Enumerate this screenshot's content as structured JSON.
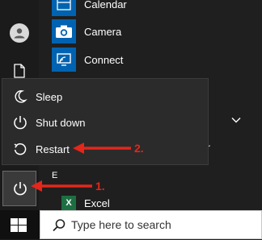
{
  "apps": [
    {
      "label": "Calendar",
      "icon": "calendar-icon"
    },
    {
      "label": "Camera",
      "icon": "camera-icon"
    },
    {
      "label": "Connect",
      "icon": "connect-icon"
    }
  ],
  "section_letter": "E",
  "excel": {
    "tile": "X",
    "label": "Excel",
    "icon": "excel-icon"
  },
  "partial_text": "r",
  "power_menu": {
    "items": [
      {
        "label": "Sleep",
        "icon": "moon-icon"
      },
      {
        "label": "Shut down",
        "icon": "power-icon"
      },
      {
        "label": "Restart",
        "icon": "restart-icon"
      }
    ]
  },
  "annotations": {
    "step1": "1.",
    "step2": "2.",
    "color": "#e4261b"
  },
  "taskbar": {
    "search_placeholder": "Type here to search",
    "start_icon": "windows-logo-icon"
  },
  "colors": {
    "tile_blue": "#0063b1",
    "excel_green": "#1d6f42",
    "menu_bg": "#2b2b2b"
  }
}
